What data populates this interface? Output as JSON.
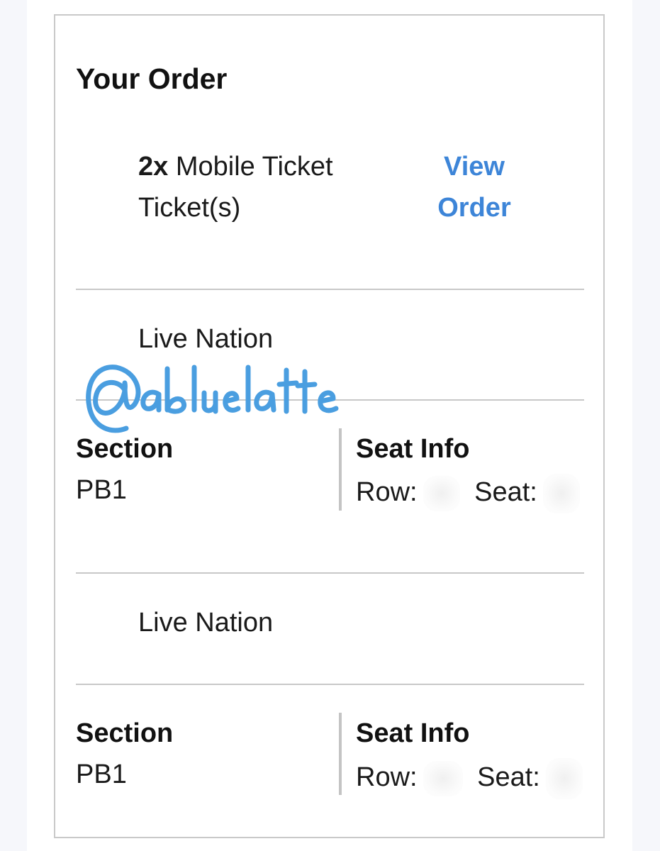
{
  "order": {
    "heading": "Your Order",
    "quantity": "2x",
    "ticket_type": "Mobile Ticket",
    "ticket_suffix": "Ticket(s)",
    "view_order_label_line1": "View",
    "view_order_label_line2": "Order"
  },
  "tickets": [
    {
      "organizer": "Live Nation",
      "section_label": "Section",
      "section_value": "PB1",
      "seat_info_label": "Seat Info",
      "row_label": "Row:",
      "seat_label": "Seat:"
    },
    {
      "organizer": "Live Nation",
      "section_label": "Section",
      "section_value": "PB1",
      "seat_info_label": "Seat Info",
      "row_label": "Row:",
      "seat_label": "Seat:"
    }
  ],
  "watermark": {
    "text": "@abluelatte",
    "color": "#4a9ee0"
  },
  "colors": {
    "link": "#3d85d8",
    "divider": "#c8c8c8",
    "text": "#111111"
  }
}
